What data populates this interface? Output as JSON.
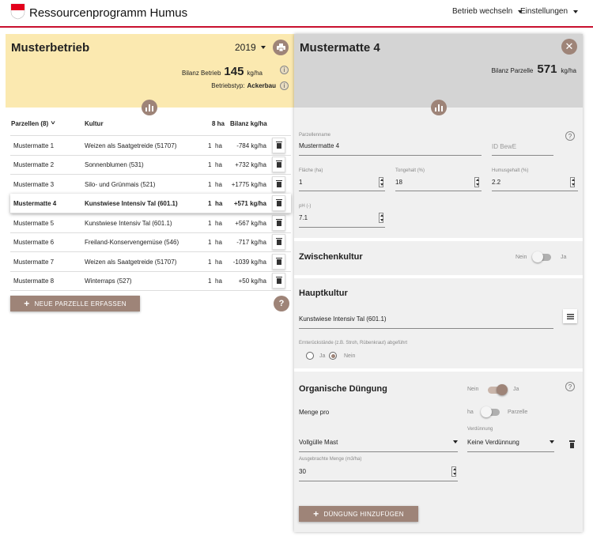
{
  "app": {
    "title": "Ressourcenprogramm Humus",
    "nav": {
      "switch": "Betrieb wechseln",
      "settings": "Einstellungen"
    }
  },
  "colors": {
    "accent": "#c8102e",
    "brown": "#9e8478",
    "yellow": "#fbe9b0",
    "gray": "#d4d4d4"
  },
  "farm": {
    "name": "Musterbetrieb",
    "year": "2019",
    "bilanz_label": "Bilanz Betrieb",
    "bilanz_value": "145",
    "bilanz_unit": "kg/ha",
    "typ_label": "Betriebstyp:",
    "typ_value": "Ackerbau"
  },
  "table": {
    "headers": {
      "parcel": "Parzellen (8)",
      "crop": "Kultur",
      "ha": "8 ha",
      "balance": "Bilanz kg/ha"
    },
    "rows": [
      {
        "name": "Mustermatte 1",
        "crop": "Weizen als Saatgetreide (51707)",
        "ha": "1",
        "unit": "ha",
        "balance": "-784 kg/ha"
      },
      {
        "name": "Mustermatte 2",
        "crop": "Sonnenblumen (531)",
        "ha": "1",
        "unit": "ha",
        "balance": "+732 kg/ha"
      },
      {
        "name": "Mustermatte 3",
        "crop": "Silo- und Grünmais (521)",
        "ha": "1",
        "unit": "ha",
        "balance": "+1775 kg/ha"
      },
      {
        "name": "Mustermatte 4",
        "crop": "Kunstwiese Intensiv Tal (601.1)",
        "ha": "1",
        "unit": "ha",
        "balance": "+571 kg/ha"
      },
      {
        "name": "Mustermatte 5",
        "crop": "Kunstwiese Intensiv Tal (601.1)",
        "ha": "1",
        "unit": "ha",
        "balance": "+567 kg/ha"
      },
      {
        "name": "Mustermatte 6",
        "crop": "Freiland-Konservengemüse (546)",
        "ha": "1",
        "unit": "ha",
        "balance": "-717 kg/ha"
      },
      {
        "name": "Mustermatte 7",
        "crop": "Weizen als Saatgetreide (51707)",
        "ha": "1",
        "unit": "ha",
        "balance": "-1039 kg/ha"
      },
      {
        "name": "Mustermatte 8",
        "crop": "Winterraps (527)",
        "ha": "1",
        "unit": "ha",
        "balance": "+50 kg/ha"
      }
    ],
    "add_button": "NEUE PARZELLE ERFASSEN"
  },
  "parcel": {
    "title": "Mustermatte 4",
    "bilanz_label": "Bilanz Parzelle",
    "bilanz_value": "571",
    "bilanz_unit": "kg/ha",
    "name_label": "Parzellenname",
    "name_value": "Mustermatte 4",
    "id_placeholder": "ID BewE",
    "area_label": "Fläche (ha)",
    "area_value": "1",
    "clay_label": "Tongehalt (%)",
    "clay_value": "18",
    "humus_label": "Humusgehalt (%)",
    "humus_value": "2.2",
    "ph_label": "pH (-)",
    "ph_value": "7.1"
  },
  "zwischenkultur": {
    "title": "Zwischenkultur",
    "no": "Nein",
    "yes": "Ja"
  },
  "hauptkultur": {
    "title": "Hauptkultur",
    "crop": "Kunstwiese Intensiv Tal (601.1)",
    "residue_label": "Ernterückstände (z.B. Stroh, Rübenkraut) abgeführt",
    "yes": "Ja",
    "no": "Nein"
  },
  "duengung": {
    "title": "Organische Düngung",
    "no": "Nein",
    "yes": "Ja",
    "menge_label": "Menge pro",
    "ha": "ha",
    "parzelle": "Parzelle",
    "type_value": "Vollgülle Mast",
    "dilution_label": "Verdünnung",
    "dilution_value": "Keine Verdünnung",
    "amount_label": "Ausgebrachte Menge (m3/ha)",
    "amount_value": "30",
    "add_button": "DÜNGUNG HINZUFÜGEN"
  }
}
